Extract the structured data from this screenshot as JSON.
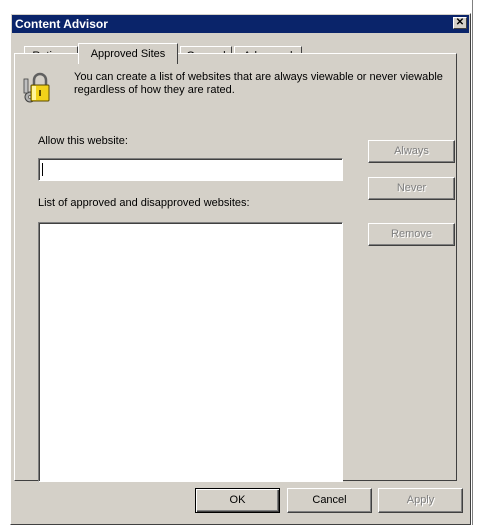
{
  "dialog": {
    "title": "Content Advisor",
    "close_glyph": "✕"
  },
  "tabs": [
    {
      "label": "Ratings",
      "active": false
    },
    {
      "label": "Approved Sites",
      "active": true
    },
    {
      "label": "General",
      "active": false
    },
    {
      "label": "Advanced",
      "active": false
    }
  ],
  "panel": {
    "description": "You can create a list of websites that are always viewable or never viewable regardless of how they are rated.",
    "allow_label": "Allow this website:",
    "website_value": "",
    "list_label": "List of approved and disapproved websites:",
    "approved_sites": []
  },
  "side_buttons": {
    "always": "Always",
    "never": "Never",
    "remove": "Remove"
  },
  "footer_buttons": {
    "ok": "OK",
    "cancel": "Cancel",
    "apply": "Apply"
  },
  "icons": {
    "lock": "lock-key-icon"
  },
  "colors": {
    "titlebar": "#0a246a",
    "face": "#d4d0c8",
    "disabled_text": "#808080"
  }
}
